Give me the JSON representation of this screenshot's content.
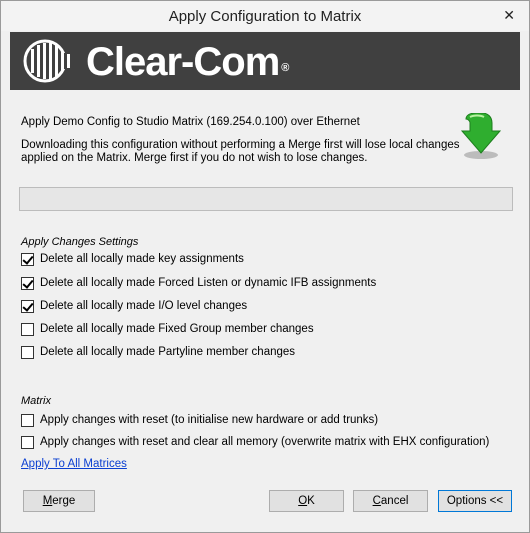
{
  "window": {
    "title": "Apply Configuration to Matrix",
    "close_glyph": "✕"
  },
  "brand": {
    "logo_text": "Clear-Com",
    "registered": "®"
  },
  "info": {
    "line1": "Apply Demo Config to Studio Matrix (169.254.0.100) over Ethernet",
    "warning_line1": "Downloading this configuration without performing a Merge first will lose local changes",
    "warning_line2": "applied on the Matrix. Merge first if you do not wish to lose changes.",
    "icon": "download-arrow-icon"
  },
  "apply_changes": {
    "heading": "Apply Changes Settings",
    "options": [
      {
        "label": "Delete all locally made key assignments",
        "checked": true
      },
      {
        "label": "Delete all locally made Forced Listen or dynamic IFB assignments",
        "checked": true
      },
      {
        "label": "Delete all locally made I/O level changes",
        "checked": true
      },
      {
        "label": "Delete all locally made Fixed Group member changes",
        "checked": false
      },
      {
        "label": "Delete all locally made Partyline member changes",
        "checked": false
      }
    ]
  },
  "matrix": {
    "heading": "Matrix",
    "options": [
      {
        "label": "Apply changes with reset (to initialise new hardware or add trunks)",
        "checked": false
      },
      {
        "label": "Apply changes with reset and clear all memory (overwrite matrix with EHX configuration)",
        "checked": false
      }
    ],
    "link": "Apply To All Matrices"
  },
  "buttons": {
    "merge_first": "M",
    "merge_rest": "erge",
    "ok_first": "O",
    "ok_rest": "K",
    "cancel_first": "C",
    "cancel_rest": "ancel",
    "options": "Options <<"
  },
  "colors": {
    "banner": "#404040",
    "arrow_green": "#2fae2f",
    "link": "#0b3fd1",
    "default_button_border": "#0078d7"
  }
}
